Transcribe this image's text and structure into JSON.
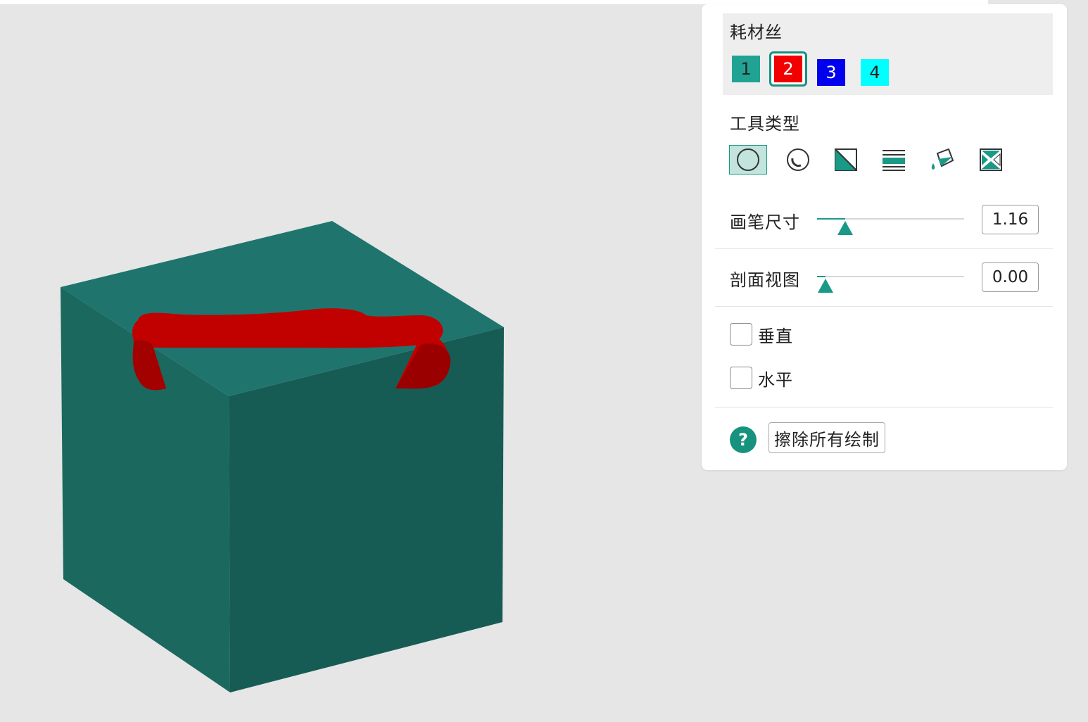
{
  "panel": {
    "filament": {
      "title": "耗材丝",
      "swatches": [
        {
          "label": "1",
          "color": "#21a394",
          "text_color": "#222222"
        },
        {
          "label": "2",
          "color": "#f20000",
          "text_color": "#ffffff",
          "selected": true
        },
        {
          "label": "3",
          "color": "#0000ee",
          "text_color": "#ffffff"
        },
        {
          "label": "4",
          "color": "#00ffff",
          "text_color": "#222222"
        }
      ]
    },
    "tool_type": {
      "title": "工具类型",
      "tools": [
        {
          "icon": "circle-brush-icon",
          "active": true
        },
        {
          "icon": "sphere-brush-icon"
        },
        {
          "icon": "triangle-fill-icon"
        },
        {
          "icon": "height-range-icon"
        },
        {
          "icon": "paint-bucket-icon"
        },
        {
          "icon": "gap-fill-icon"
        }
      ]
    },
    "brush_size": {
      "label": "画笔尺寸",
      "value": "1.16",
      "level": 0.18
    },
    "section_view": {
      "label": "剖面视图",
      "value": "0.00",
      "level": 0.0
    },
    "vertical": {
      "label": "垂直",
      "checked": false
    },
    "horizontal": {
      "label": "水平",
      "checked": false
    },
    "erase_all": {
      "label": "擦除所有绘制"
    },
    "help_icon": {
      "glyph": "?"
    }
  },
  "colors": {
    "accent": "#1a9986",
    "cube_top": "#1f756d",
    "cube_front": "#165c55",
    "paint": "#c10000"
  }
}
